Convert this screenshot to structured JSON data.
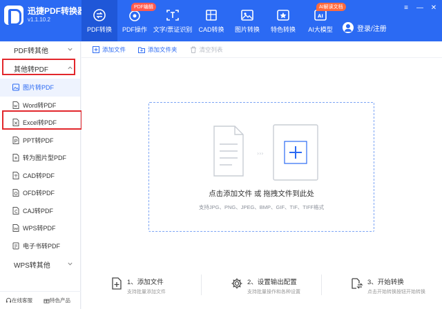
{
  "app": {
    "name": "迅捷PDF转换器",
    "version": "v1.1.10.2"
  },
  "nav": {
    "items": [
      {
        "label": "PDF转换",
        "active": true
      },
      {
        "label": "PDF操作",
        "badge": "PDF编辑"
      },
      {
        "label": "文字/票证识别"
      },
      {
        "label": "CAD转换"
      },
      {
        "label": "图片转换"
      },
      {
        "label": "特色转换"
      },
      {
        "label": "AI大模型",
        "badge": "AI解读文档"
      }
    ]
  },
  "user": {
    "login_label": "登录/注册"
  },
  "window_controls": {
    "menu": "≡",
    "minimize": "—",
    "close": "✕"
  },
  "sidebar": {
    "sections": [
      {
        "label": "PDF转其他",
        "expanded": false
      },
      {
        "label": "其他转PDF",
        "expanded": true
      }
    ],
    "items": [
      {
        "label": "图片转PDF",
        "icon": "image-icon",
        "active": true
      },
      {
        "label": "Word转PDF",
        "icon": "word-icon"
      },
      {
        "label": "Excel转PDF",
        "icon": "excel-icon"
      },
      {
        "label": "PPT转PDF",
        "icon": "ppt-icon"
      },
      {
        "label": "转为图片型PDF",
        "icon": "file-icon"
      },
      {
        "label": "CAD转PDF",
        "icon": "cad-icon"
      },
      {
        "label": "OFD转PDF",
        "icon": "ofd-icon"
      },
      {
        "label": "CAJ转PDF",
        "icon": "caj-icon"
      },
      {
        "label": "WPS转PDF",
        "icon": "wps-icon"
      },
      {
        "label": "电子书转PDF",
        "icon": "ebook-icon"
      }
    ],
    "bottom_section": {
      "label": "WPS转其他"
    },
    "footer": {
      "service": "在线客服",
      "featured": "特色产品"
    }
  },
  "toolbar": {
    "add_file": "添加文件",
    "add_folder": "添加文件夹",
    "clear_list": "清空列表"
  },
  "dropzone": {
    "title": "点击添加文件 或 拖拽文件到此处",
    "formats": "支持JPG、PNG、JPEG、BMP、GIF、TIF、TIFF格式"
  },
  "steps": [
    {
      "title": "1、添加文件",
      "desc": "支持批量添加文件",
      "icon": "add-file-icon"
    },
    {
      "title": "2、设置输出配置",
      "desc": "支持批量操作和各种设置",
      "icon": "gear-icon"
    },
    {
      "title": "3、开始转换",
      "desc": "点击开始转换按钮开始转换",
      "icon": "convert-icon"
    }
  ],
  "colors": {
    "brand": "#2b6af3",
    "highlight": "#e2262b",
    "badge": "#ff5a4e"
  }
}
